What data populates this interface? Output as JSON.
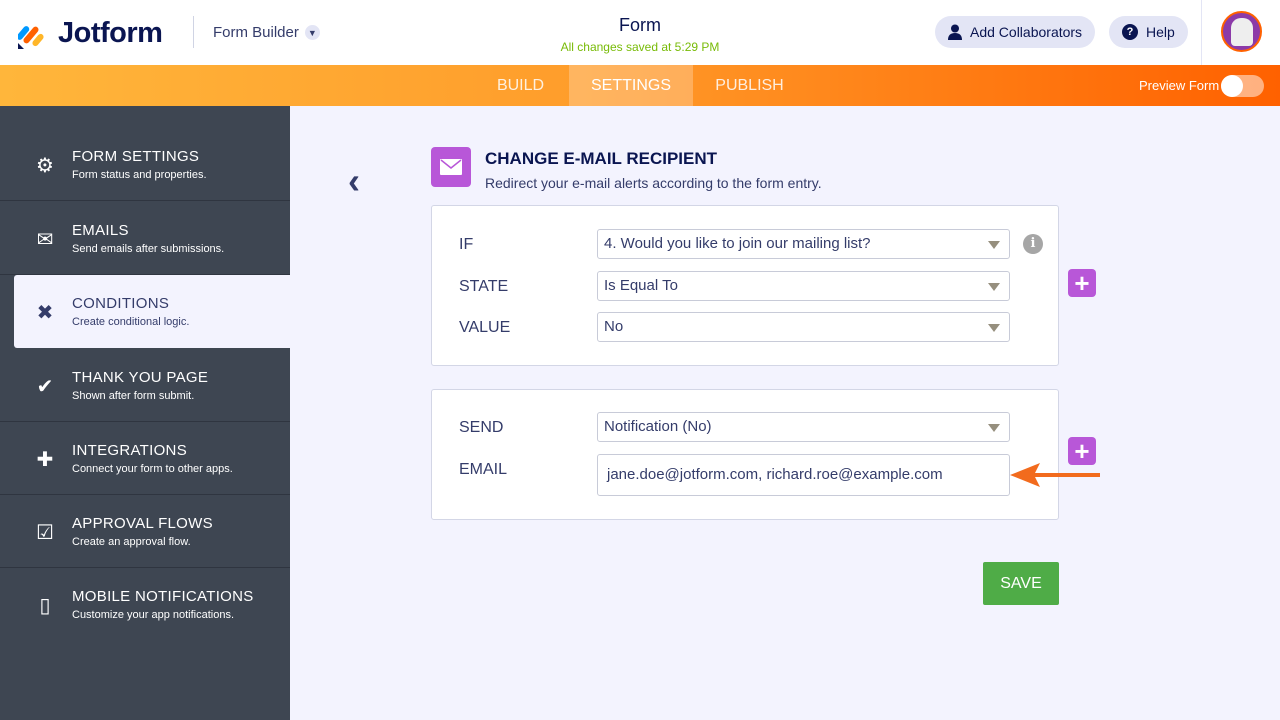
{
  "header": {
    "brand": "Jotform",
    "app": "Form Builder",
    "form_title": "Form",
    "save_status": "All changes saved at 5:29 PM",
    "add_collaborators": "Add Collaborators",
    "help": "Help"
  },
  "nav": {
    "tabs": [
      "BUILD",
      "SETTINGS",
      "PUBLISH"
    ],
    "active": "SETTINGS",
    "preview": "Preview Form",
    "preview_on": false
  },
  "sidebar": {
    "items": [
      {
        "title": "FORM SETTINGS",
        "sub": "Form status and properties.",
        "icon": "gear-icon"
      },
      {
        "title": "EMAILS",
        "sub": "Send emails after submissions.",
        "icon": "envelope-icon"
      },
      {
        "title": "CONDITIONS",
        "sub": "Create conditional logic.",
        "icon": "shuffle-icon"
      },
      {
        "title": "THANK YOU PAGE",
        "sub": "Shown after form submit.",
        "icon": "check-circle-icon"
      },
      {
        "title": "INTEGRATIONS",
        "sub": "Connect your form to other apps.",
        "icon": "puzzle-icon"
      },
      {
        "title": "APPROVAL FLOWS",
        "sub": "Create an approval flow.",
        "icon": "approval-icon"
      },
      {
        "title": "MOBILE NOTIFICATIONS",
        "sub": "Customize your app notifications.",
        "icon": "mobile-icon"
      }
    ]
  },
  "main": {
    "title": "CHANGE E-MAIL RECIPIENT",
    "subtitle": "Redirect your e-mail alerts according to the form entry.",
    "condition": {
      "if_label": "IF",
      "if_value": "4. Would you like to join our mailing list?",
      "state_label": "STATE",
      "state_value": "Is Equal To",
      "value_label": "VALUE",
      "value_value": "No"
    },
    "action": {
      "send_label": "SEND",
      "send_value": "Notification (No)",
      "email_label": "EMAIL",
      "email_value": "jane.doe@jotform.com, richard.roe@example.com"
    },
    "save": "SAVE"
  },
  "colors": {
    "accent": "#ff6100",
    "purple": "#b857d8",
    "save": "#4fac47"
  }
}
